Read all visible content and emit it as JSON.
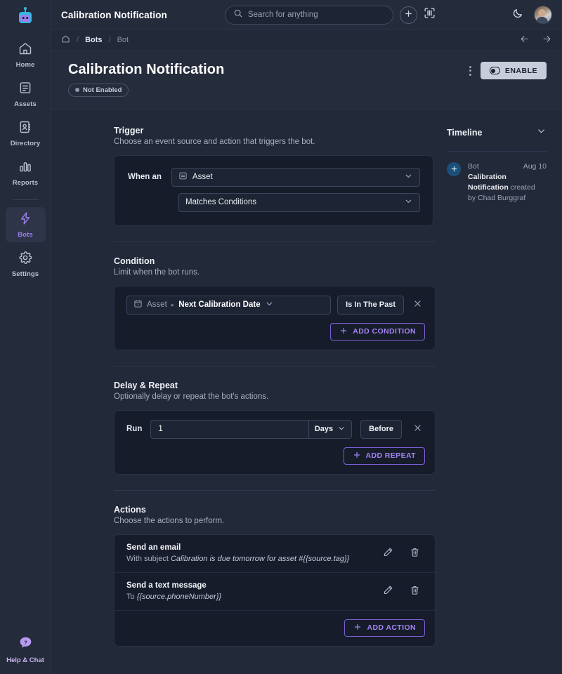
{
  "app": {
    "logo_icon": "robot-logo-icon",
    "accent": "#9d7df0",
    "page_bg": "#222938",
    "card_bg": "#171c2b"
  },
  "sidebar": {
    "items": [
      {
        "label": "Home",
        "icon": "home-icon",
        "active": false
      },
      {
        "label": "Assets",
        "icon": "assets-icon",
        "active": false
      },
      {
        "label": "Directory",
        "icon": "directory-icon",
        "active": false
      },
      {
        "label": "Reports",
        "icon": "reports-icon",
        "active": false
      },
      {
        "label": "Bots",
        "icon": "bolt-icon",
        "active": true
      },
      {
        "label": "Settings",
        "icon": "gear-icon",
        "active": false
      }
    ],
    "help": {
      "label": "Help & Chat",
      "icon": "help-chat-icon"
    }
  },
  "topbar": {
    "title": "Calibration Notification",
    "search": {
      "placeholder": "Search for anything",
      "value": "",
      "icon": "search-icon"
    },
    "add_button_icon": "plus-icon",
    "scan_button_icon": "barcode-scan-icon",
    "theme_toggle_icon": "moon-icon",
    "avatar_icon": "user-avatar"
  },
  "breadcrumb": {
    "home_icon": "home-outline-icon",
    "items": [
      "Bots",
      "Bot"
    ],
    "separator": "/",
    "back_icon": "arrow-left-icon",
    "forward_icon": "arrow-right-icon"
  },
  "page_header": {
    "title": "Calibration Notification",
    "status": "Not Enabled",
    "kebab_icon": "more-vertical-icon",
    "enable_label": "ENABLE",
    "enable_icon": "toggle-icon"
  },
  "trigger": {
    "title": "Trigger",
    "subtitle": "Choose an event source and action that triggers the bot.",
    "when_label": "When an",
    "source_icon": "asset-icon",
    "source_value": "Asset",
    "action_value": "Matches Conditions",
    "chevron_icon": "chevron-down-icon"
  },
  "condition": {
    "title": "Condition",
    "subtitle": "Limit when the bot runs.",
    "rows": [
      {
        "field_icon": "calendar-icon",
        "prefix": "Asset",
        "arrow": "▸",
        "field": "Next Calibration Date",
        "operator": "Is In The Past",
        "remove_icon": "close-icon"
      }
    ],
    "add_label": "ADD CONDITION",
    "add_icon": "plus-icon"
  },
  "delay": {
    "title": "Delay & Repeat",
    "subtitle": "Optionally delay or repeat the bot's actions.",
    "run_label": "Run",
    "amount": "1",
    "unit": "Days",
    "relation": "Before",
    "remove_icon": "close-icon",
    "add_label": "ADD REPEAT",
    "add_icon": "plus-icon"
  },
  "actions": {
    "title": "Actions",
    "subtitle": "Choose the actions to perform.",
    "items": [
      {
        "title": "Send an email",
        "sub_prefix": "With subject ",
        "sub_value": "Calibration is due tomorrow for asset #{{source.tag}}",
        "edit_icon": "pencil-icon",
        "delete_icon": "trash-icon"
      },
      {
        "title": "Send a text message",
        "sub_prefix": "To ",
        "sub_value": "{{source.phoneNumber}}",
        "edit_icon": "pencil-icon",
        "delete_icon": "trash-icon"
      }
    ],
    "add_label": "ADD ACTION",
    "add_icon": "plus-icon"
  },
  "timeline": {
    "title": "Timeline",
    "collapse_icon": "chevron-down-icon",
    "entries": [
      {
        "bullet_icon": "plus-icon",
        "prefix": "Bot ",
        "name": "Calibration Notification",
        "suffix": " created",
        "date": "Aug 10",
        "by": "by Chad Burggraf"
      }
    ]
  }
}
